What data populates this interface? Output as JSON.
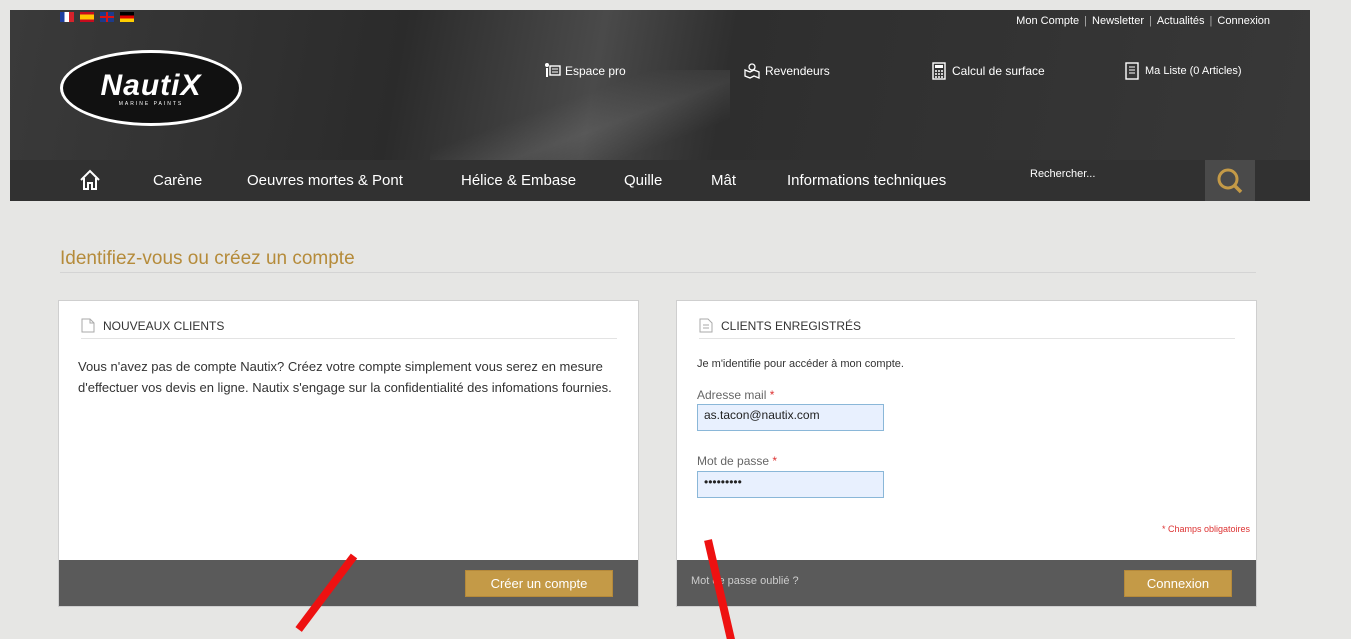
{
  "header": {
    "flags": [
      "fr-flag",
      "es-flag",
      "uk-flag",
      "de-flag"
    ],
    "toplinks": [
      "Mon Compte",
      "Newsletter",
      "Actualités",
      "Connexion"
    ],
    "logo_text": "NautiX",
    "logo_sub": "MARINE PAINTS",
    "links": {
      "pro": "Espace pro",
      "dealers": "Revendeurs",
      "surface": "Calcul de surface",
      "list": "Ma Liste (0 Articles)"
    }
  },
  "nav": {
    "items": [
      "Carène",
      "Oeuvres mortes & Pont",
      "Hélice & Embase",
      "Quille",
      "Mât",
      "Informations techniques"
    ],
    "search_placeholder": "Rechercher..."
  },
  "page": {
    "title": "Identifiez-vous ou créez un compte"
  },
  "new_clients": {
    "heading": "NOUVEAUX CLIENTS",
    "text": "Vous n'avez pas de compte Nautix? Créez votre compte simplement vous serez en mesure d'effectuer vos devis en ligne. Nautix s'engage sur la confidentialité des infomations fournies.",
    "button": "Créer un compte"
  },
  "registered": {
    "heading": "CLIENTS ENREGISTRÉS",
    "intro": "Je m'identifie pour accéder à mon compte.",
    "email_label": "Adresse mail",
    "email_value": "as.tacon@nautix.com",
    "password_label": "Mot de passe",
    "password_value": "•••••••••",
    "required_mark": "*",
    "required_note": "* Champs obligatoires",
    "forgot": "Mot de passe oublié ?",
    "button": "Connexion"
  },
  "colors": {
    "accent": "#c49a47",
    "title": "#b58b3a",
    "annotation": "#ee1111"
  }
}
